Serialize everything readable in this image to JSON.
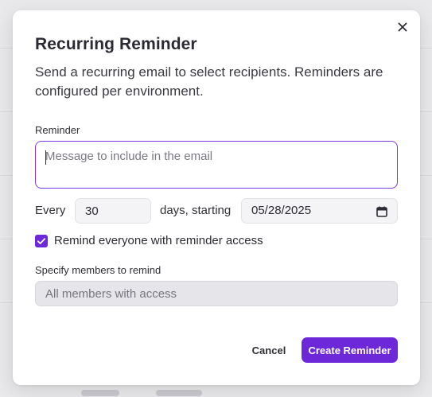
{
  "modal": {
    "title": "Recurring Reminder",
    "description": "Send a recurring email to select recipients. Reminders are configured per environment.",
    "close_icon": "close-icon"
  },
  "reminder": {
    "label": "Reminder",
    "placeholder": "Message to include in the email",
    "value": ""
  },
  "schedule": {
    "every_label": "Every",
    "interval_value": "30",
    "days_starting_label": "days, starting",
    "start_date": "05/28/2025",
    "date_icon": "calendar-icon"
  },
  "remind_everyone": {
    "checked": true,
    "label": "Remind everyone with reminder access"
  },
  "members": {
    "label": "Specify members to remind",
    "placeholder": "All members with access",
    "disabled": true
  },
  "actions": {
    "cancel_label": "Cancel",
    "create_label": "Create Reminder"
  },
  "colors": {
    "accent": "#6d28d9",
    "focus_border": "#7c3aed",
    "text": "#2b2b33",
    "disabled_field": "#e6e6ea"
  }
}
